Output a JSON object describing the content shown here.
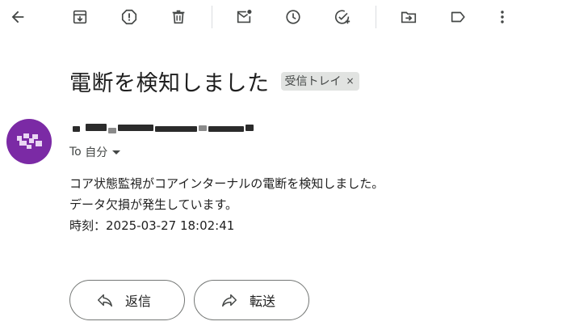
{
  "subject": "電断を検知しました",
  "label_chip": {
    "text": "受信トレイ",
    "remove_glyph": "×"
  },
  "recipient": {
    "prefix": "To",
    "name": "自分"
  },
  "body_lines": [
    "コア状態監視がコアインターナルの電断を検知しました。",
    "データ欠損が発生しています。",
    "時刻：2025-03-27 18:02:41"
  ],
  "actions": {
    "reply": "返信",
    "forward": "転送"
  },
  "avatar_color": "#7b2aa5",
  "toolbar_icons": [
    "back-arrow-icon",
    "archive-icon",
    "report-spam-icon",
    "delete-icon",
    "mark-unread-icon",
    "snooze-icon",
    "add-to-tasks-icon",
    "move-to-icon",
    "label-icon",
    "more-vert-icon"
  ]
}
